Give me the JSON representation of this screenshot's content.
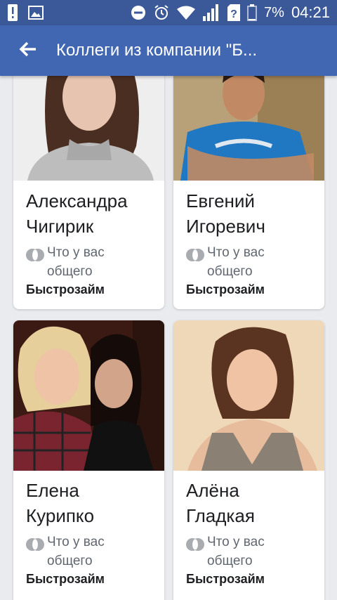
{
  "status_bar": {
    "battery_percent": "7%",
    "time": "04:21",
    "icons": [
      "alert-icon",
      "image-icon",
      "do-not-disturb-icon",
      "alarm-icon",
      "wifi-icon",
      "signal-icon",
      "unknown-sim-icon",
      "battery-icon"
    ]
  },
  "app_bar": {
    "title": "Коллеги из компании \"Б...",
    "back_icon": "arrow-left-icon",
    "colors": {
      "status_bar": "#3b5998",
      "app_bar": "#4267b2"
    }
  },
  "people": [
    {
      "first_name": "Александра",
      "last_name": "Чигирик",
      "mutual_label": "Что у вас общего",
      "company": "Быстрозайм"
    },
    {
      "first_name": "Евгений",
      "last_name": "Игоревич",
      "mutual_label": "Что у вас общего",
      "company": "Быстрозайм"
    },
    {
      "first_name": "Елена",
      "last_name": "Курипко",
      "mutual_label": "Что у вас общего",
      "company": "Быстрозайм"
    },
    {
      "first_name": "Алёна",
      "last_name": "Гладкая",
      "mutual_label": "Что у вас общего",
      "company": "Быстрозайм"
    }
  ]
}
